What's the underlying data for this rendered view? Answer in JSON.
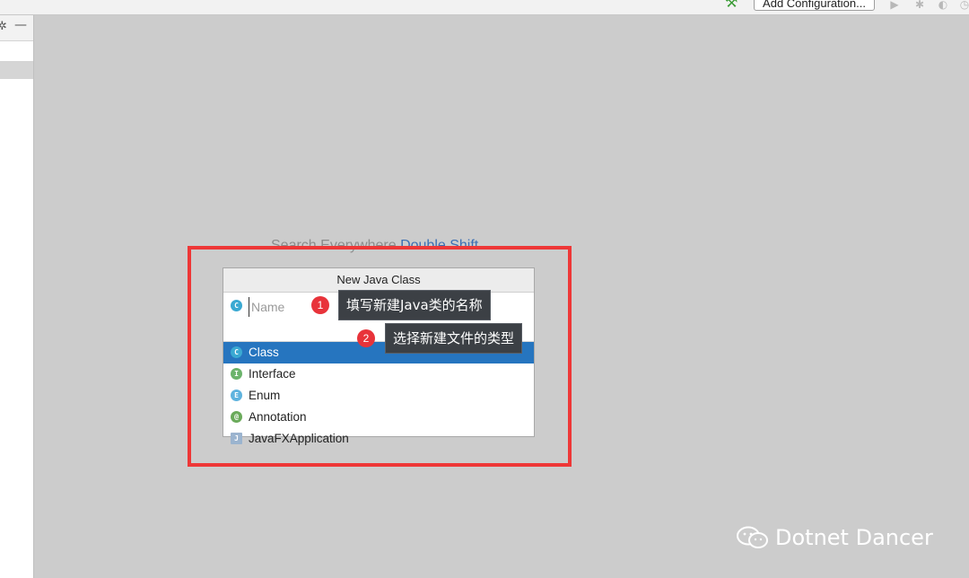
{
  "toolbar": {
    "hammer_icon": "hammer-icon",
    "add_configuration_label": "Add Configuration...",
    "run_icon": "run-icon",
    "debug_icon": "debug-icon",
    "coverage_icon": "coverage-icon",
    "profile_icon": "profile-icon"
  },
  "sidebar": {
    "gear_glyph": "✲",
    "minimize_glyph": "—"
  },
  "search_hint": {
    "prefix": "Search Everywhere",
    "shortcut": "Double Shift"
  },
  "dialog": {
    "title": "New Java Class",
    "name_placeholder": "Name",
    "name_value": "",
    "kinds": [
      {
        "label": "Class",
        "icon_glyph": "C",
        "selected": true
      },
      {
        "label": "Interface",
        "icon_glyph": "I",
        "selected": false
      },
      {
        "label": "Enum",
        "icon_glyph": "E",
        "selected": false
      },
      {
        "label": "Annotation",
        "icon_glyph": "@",
        "selected": false
      },
      {
        "label": "JavaFXApplication",
        "icon_glyph": "J",
        "selected": false
      }
    ]
  },
  "annotations": [
    {
      "number": "1",
      "text": "填写新建Java类的名称"
    },
    {
      "number": "2",
      "text": "选择新建文件的类型"
    }
  ],
  "watermark": {
    "text": "Dotnet Dancer",
    "icon": "wechat-icon"
  },
  "colors": {
    "accent_selection": "#2675bf",
    "highlight_frame": "#ee3737",
    "badge": "#e8333a"
  }
}
